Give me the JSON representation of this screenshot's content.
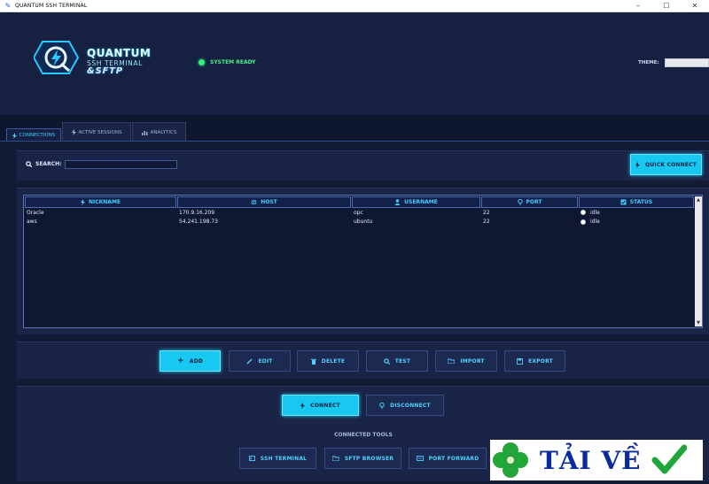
{
  "window": {
    "title": "QUANTUM SSH TERMINAL",
    "controls": {
      "minimize": "–",
      "maximize": "☐",
      "close": "✕"
    }
  },
  "header": {
    "logo": {
      "line1": "QUANTUM",
      "line2": "SSH TERMINAL",
      "line3": "&SFTP"
    },
    "status_text": "SYSTEM READY",
    "status_color": "#2ef07a",
    "theme_label": "THEME:",
    "theme_value": ""
  },
  "tabs": [
    {
      "label": "CONNECTIONS",
      "icon": "lightning-icon",
      "active": true
    },
    {
      "label": "ACTIVE SESSIONS",
      "icon": "lightning-icon",
      "active": false
    },
    {
      "label": "ANALYTICS",
      "icon": "chart-icon",
      "active": false
    }
  ],
  "search": {
    "label": "SEARCH:",
    "value": "",
    "placeholder": ""
  },
  "quick_connect_label": "QUICK CONNECT",
  "table": {
    "columns": [
      {
        "label": "NICKNAME",
        "icon": "lightning-icon"
      },
      {
        "label": "HOST",
        "icon": "globe-icon"
      },
      {
        "label": "USERNAME",
        "icon": "user-icon"
      },
      {
        "label": "PORT",
        "icon": "pin-icon"
      },
      {
        "label": "STATUS",
        "icon": "status-icon"
      }
    ],
    "rows": [
      {
        "nickname": "Oracle",
        "host": "170.9.16.209",
        "username": "opc",
        "port": "22",
        "status": "idle"
      },
      {
        "nickname": "aws",
        "host": "54.241.198.73",
        "username": "ubuntu",
        "port": "22",
        "status": "idle"
      }
    ]
  },
  "actions": {
    "add": "ADD",
    "edit": "EDIT",
    "delete": "DELETE",
    "test": "TEST",
    "import": "IMPORT",
    "export": "EXPORT"
  },
  "connection": {
    "connect": "CONNECT",
    "disconnect": "DISCONNECT"
  },
  "tools": {
    "label": "CONNECTED TOOLS",
    "ssh_terminal": "SSH TERMINAL",
    "sftp_browser": "SFTP BROWSER",
    "port_forward": "PORT FORWARD"
  },
  "watermark": {
    "text": "TẢI VỀ"
  },
  "colors": {
    "accent": "#18c8f0",
    "background": "#131b36",
    "panel": "#1a2447",
    "brand_blue": "#0a2a9e",
    "clover": "#22a53a"
  }
}
